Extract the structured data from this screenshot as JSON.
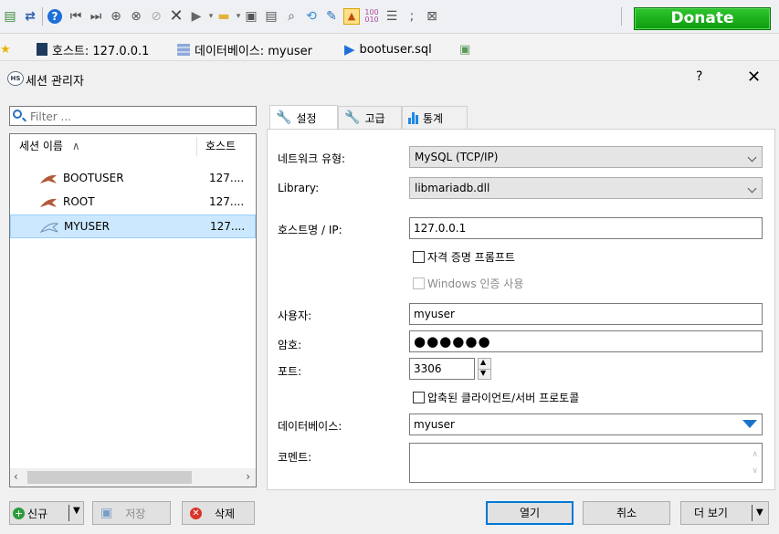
{
  "toolbar": {
    "donate_label": "Donate"
  },
  "tabs": [
    {
      "label": "호스트: 127.0.0.1"
    },
    {
      "label": "데이터베이스: myuser"
    },
    {
      "label": "bootuser.sql"
    }
  ],
  "dialog": {
    "title": "세션 관리자",
    "help": "?",
    "close": "✕"
  },
  "filter": {
    "placeholder": "Filter ..."
  },
  "sessions": {
    "col_name": "세션 이름",
    "col_host": "호스트",
    "rows": [
      {
        "name": "BOOTUSER",
        "host": "127...."
      },
      {
        "name": "ROOT",
        "host": "127...."
      },
      {
        "name": "MYUSER",
        "host": "127...."
      }
    ]
  },
  "left_buttons": {
    "new": "신규",
    "save": "저장",
    "delete": "삭제"
  },
  "settings_tabs": {
    "settings": "설정",
    "advanced": "고급",
    "stats": "통계"
  },
  "form": {
    "network_type_label": "네트워크 유형:",
    "network_type_value": "MySQL (TCP/IP)",
    "library_label": "Library:",
    "library_value": "libmariadb.dll",
    "host_label": "호스트명 / IP:",
    "host_value": "127.0.0.1",
    "credential_prompt": "자격 증명 프롬프트",
    "windows_auth": "Windows 인증 사용",
    "user_label": "사용자:",
    "user_value": "myuser",
    "password_label": "암호:",
    "password_value": "●●●●●●",
    "port_label": "포트:",
    "port_value": "3306",
    "compressed": "압축된 클라이언트/서버 프로토콜",
    "database_label": "데이터베이스:",
    "database_value": "myuser",
    "comment_label": "코멘트:"
  },
  "footer": {
    "open": "열기",
    "cancel": "취소",
    "more": "더 보기"
  },
  "colors": {
    "accent": "#0078d7",
    "selected": "#cce8ff",
    "donate": "#1fae1f"
  }
}
